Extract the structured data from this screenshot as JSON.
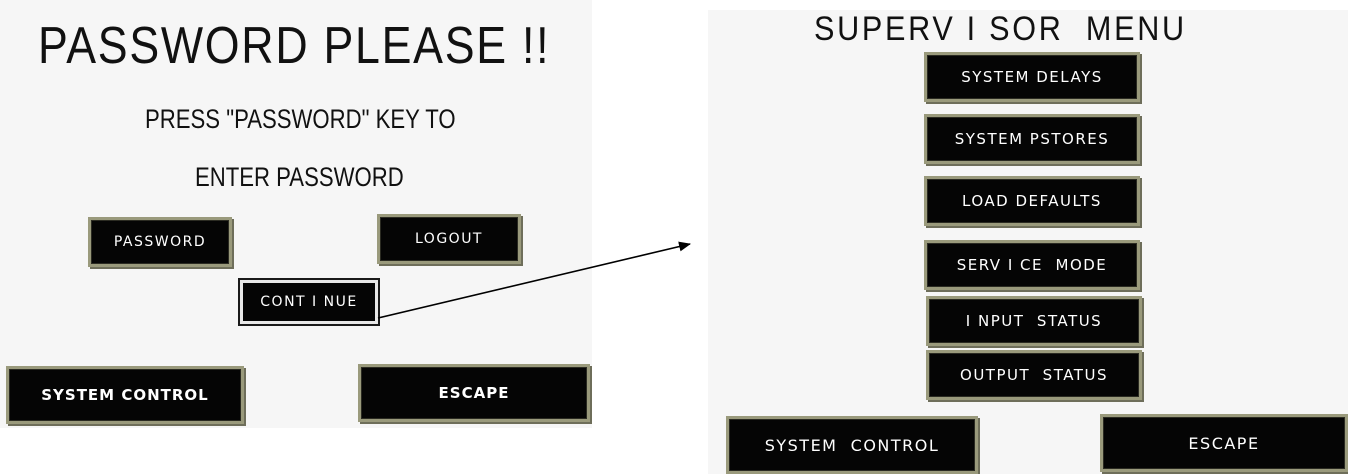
{
  "password_screen": {
    "title": "PASSWORD PLEASE !!",
    "instruction_line1": "PRESS \"PASSWORD\" KEY TO",
    "instruction_line2": "ENTER PASSWORD",
    "password_button": "PASSWORD",
    "logout_button": "LOGOUT",
    "continue_button": "CONT I NUE",
    "system_control_button": "SYSTEM CONTROL",
    "escape_button": "ESCAPE"
  },
  "supervisor_screen": {
    "title": "SUPERV I SOR  MENU",
    "menu_items": [
      "SYSTEM DELAYS",
      "SYSTEM PSTORES",
      "LOAD DEFAULTS",
      "SERV I CE  MODE",
      "I NPUT  STATUS",
      "OUTPUT  STATUS"
    ],
    "system_control_button": "SYSTEM  CONTROL",
    "escape_button": "ESCAPE"
  },
  "colors": {
    "button_bg": "#050505",
    "button_border": "#9a9a7c",
    "panel_bg": "#f6f6f6"
  }
}
